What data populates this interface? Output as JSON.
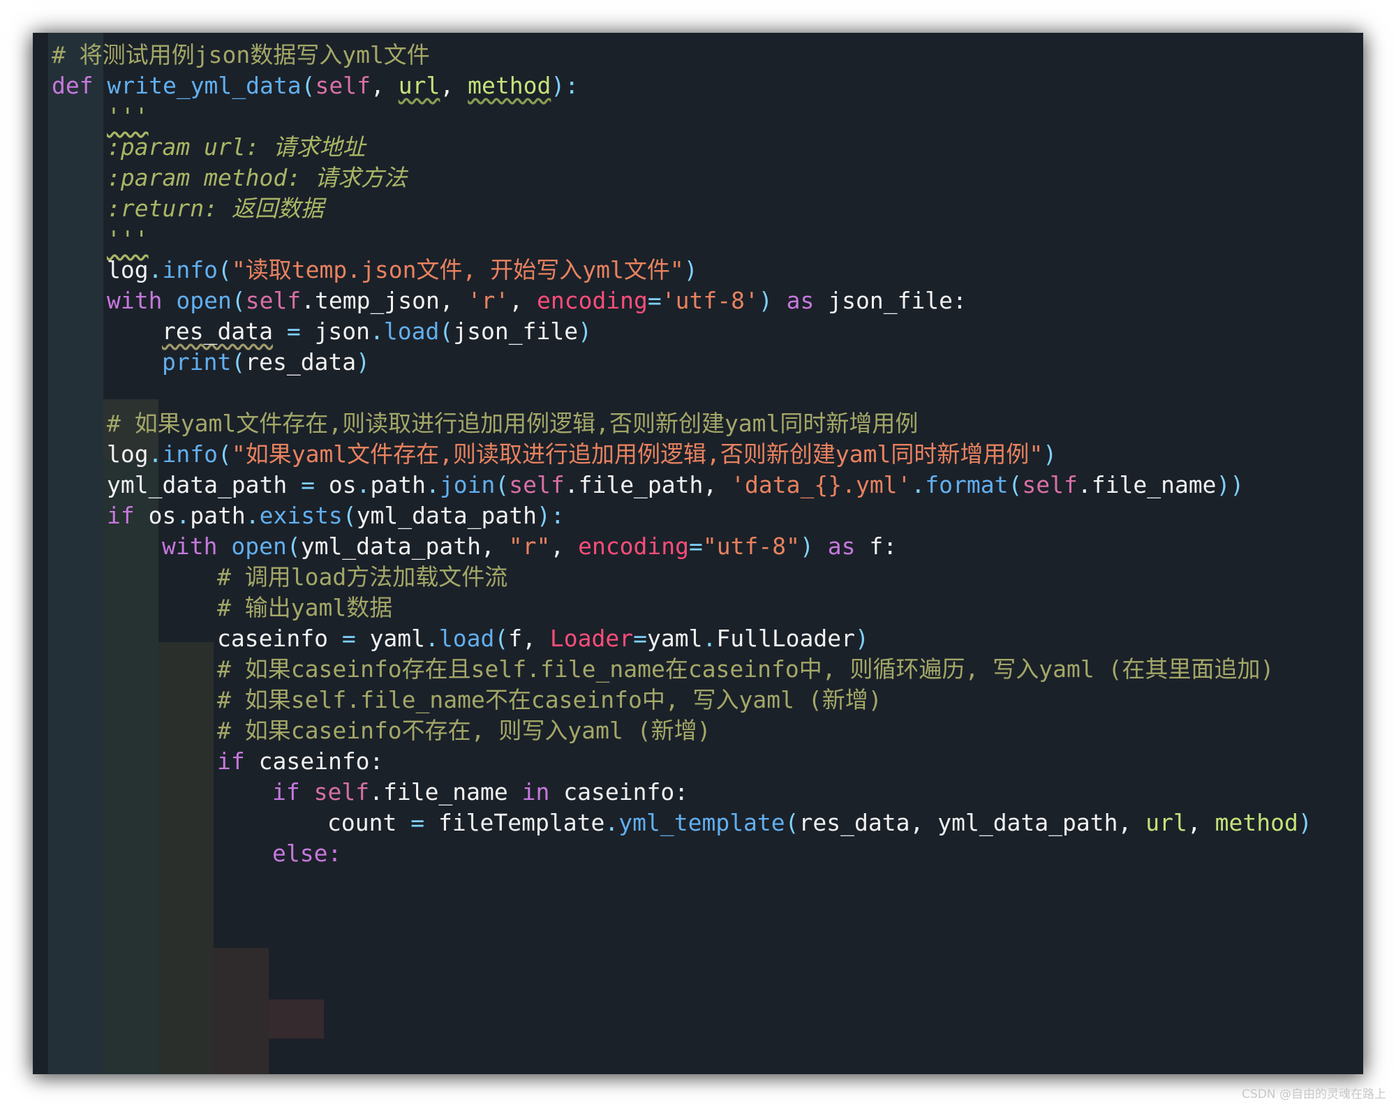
{
  "code_lines": [
    [
      {
        "t": "# 将测试用例json数据写入yml文件",
        "c": "c-comment"
      }
    ],
    [
      {
        "t": "def ",
        "c": "c-def"
      },
      {
        "t": "write_yml_data",
        "c": "c-fn"
      },
      {
        "t": "(",
        "c": "c-op"
      },
      {
        "t": "self",
        "c": "c-self"
      },
      {
        "t": ", ",
        "c": "c-plain"
      },
      {
        "t": "url",
        "c": "c-param"
      },
      {
        "t": ", ",
        "c": "c-plain"
      },
      {
        "t": "method",
        "c": "c-param"
      },
      {
        "t": "):",
        "c": "c-op"
      }
    ],
    [
      {
        "t": "'''",
        "c": "doc-quote"
      }
    ],
    [
      {
        "t": ":param url: ",
        "c": "c-doc"
      },
      {
        "t": "请求地址",
        "c": "c-doc"
      }
    ],
    [
      {
        "t": ":param method: ",
        "c": "c-doc"
      },
      {
        "t": "请求方法",
        "c": "c-doc"
      }
    ],
    [
      {
        "t": ":return: ",
        "c": "c-doc"
      },
      {
        "t": "返回数据",
        "c": "c-doc"
      }
    ],
    [
      {
        "t": "'''",
        "c": "doc-quote"
      }
    ],
    [
      {
        "t": "log",
        "c": "c-plain"
      },
      {
        "t": ".",
        "c": "c-op"
      },
      {
        "t": "info",
        "c": "c-call"
      },
      {
        "t": "(",
        "c": "c-op"
      },
      {
        "t": "\"读取temp.json文件, 开始写入yml文件\"",
        "c": "c-str"
      },
      {
        "t": ")",
        "c": "c-op"
      }
    ],
    [
      {
        "t": "with ",
        "c": "c-kw"
      },
      {
        "t": "open",
        "c": "c-call"
      },
      {
        "t": "(",
        "c": "c-op"
      },
      {
        "t": "self",
        "c": "c-self"
      },
      {
        "t": ".temp_json, ",
        "c": "c-plain"
      },
      {
        "t": "'r'",
        "c": "c-str"
      },
      {
        "t": ", ",
        "c": "c-plain"
      },
      {
        "t": "encoding",
        "c": "c-kwarg"
      },
      {
        "t": "=",
        "c": "c-op"
      },
      {
        "t": "'utf-8'",
        "c": "c-str"
      },
      {
        "t": ") ",
        "c": "c-op"
      },
      {
        "t": "as ",
        "c": "c-kw"
      },
      {
        "t": "json_file:",
        "c": "c-plain"
      }
    ],
    [
      {
        "t": "res_data",
        "c": "c-plain c-var-uw"
      },
      {
        "t": " = ",
        "c": "c-op"
      },
      {
        "t": "json",
        "c": "c-plain"
      },
      {
        "t": ".",
        "c": "c-op"
      },
      {
        "t": "load",
        "c": "c-call"
      },
      {
        "t": "(",
        "c": "c-op"
      },
      {
        "t": "json_file",
        "c": "c-plain"
      },
      {
        "t": ")",
        "c": "c-op"
      }
    ],
    [
      {
        "t": "print",
        "c": "c-call"
      },
      {
        "t": "(",
        "c": "c-op"
      },
      {
        "t": "res_data",
        "c": "c-plain"
      },
      {
        "t": ")",
        "c": "c-op"
      }
    ],
    [],
    [
      {
        "t": "# 如果yaml文件存在,则读取进行追加用例逻辑,否则新创建yaml同时新增用例",
        "c": "c-comment"
      }
    ],
    [
      {
        "t": "log",
        "c": "c-plain"
      },
      {
        "t": ".",
        "c": "c-op"
      },
      {
        "t": "info",
        "c": "c-call"
      },
      {
        "t": "(",
        "c": "c-op"
      },
      {
        "t": "\"如果yaml文件存在,则读取进行追加用例逻辑,否则新创建yaml同时新增用例\"",
        "c": "c-str"
      },
      {
        "t": ")",
        "c": "c-op"
      }
    ],
    [
      {
        "t": "yml_data_path",
        "c": "c-plain"
      },
      {
        "t": " = ",
        "c": "c-op"
      },
      {
        "t": "os",
        "c": "c-plain"
      },
      {
        "t": ".",
        "c": "c-op"
      },
      {
        "t": "path",
        "c": "c-plain"
      },
      {
        "t": ".",
        "c": "c-op"
      },
      {
        "t": "join",
        "c": "c-call"
      },
      {
        "t": "(",
        "c": "c-op"
      },
      {
        "t": "self",
        "c": "c-self"
      },
      {
        "t": ".file_path, ",
        "c": "c-plain"
      },
      {
        "t": "'data_{}.yml'",
        "c": "c-str"
      },
      {
        "t": ".",
        "c": "c-op"
      },
      {
        "t": "format",
        "c": "c-call"
      },
      {
        "t": "(",
        "c": "c-op"
      },
      {
        "t": "self",
        "c": "c-self"
      },
      {
        "t": ".file_name",
        "c": "c-plain"
      },
      {
        "t": "))",
        "c": "c-op"
      }
    ],
    [
      {
        "t": "if ",
        "c": "c-kw"
      },
      {
        "t": "os",
        "c": "c-plain"
      },
      {
        "t": ".",
        "c": "c-op"
      },
      {
        "t": "path",
        "c": "c-plain"
      },
      {
        "t": ".",
        "c": "c-op"
      },
      {
        "t": "exists",
        "c": "c-call"
      },
      {
        "t": "(",
        "c": "c-op"
      },
      {
        "t": "yml_data_path",
        "c": "c-plain"
      },
      {
        "t": "):",
        "c": "c-op"
      }
    ],
    [
      {
        "t": "with ",
        "c": "c-kw"
      },
      {
        "t": "open",
        "c": "c-call"
      },
      {
        "t": "(",
        "c": "c-op"
      },
      {
        "t": "yml_data_path, ",
        "c": "c-plain"
      },
      {
        "t": "\"r\"",
        "c": "c-str"
      },
      {
        "t": ", ",
        "c": "c-plain"
      },
      {
        "t": "encoding",
        "c": "c-kwarg"
      },
      {
        "t": "=",
        "c": "c-op"
      },
      {
        "t": "\"utf-8\"",
        "c": "c-str"
      },
      {
        "t": ") ",
        "c": "c-op"
      },
      {
        "t": "as ",
        "c": "c-kw"
      },
      {
        "t": "f:",
        "c": "c-plain"
      }
    ],
    [
      {
        "t": "# 调用load方法加载文件流",
        "c": "c-comment"
      }
    ],
    [
      {
        "t": "# 输出yaml数据",
        "c": "c-comment"
      }
    ],
    [
      {
        "t": "caseinfo",
        "c": "c-plain"
      },
      {
        "t": " = ",
        "c": "c-op"
      },
      {
        "t": "yaml",
        "c": "c-plain"
      },
      {
        "t": ".",
        "c": "c-op"
      },
      {
        "t": "load",
        "c": "c-call"
      },
      {
        "t": "(",
        "c": "c-op"
      },
      {
        "t": "f, ",
        "c": "c-plain"
      },
      {
        "t": "Loader",
        "c": "c-kwarg"
      },
      {
        "t": "=",
        "c": "c-op"
      },
      {
        "t": "yaml",
        "c": "c-plain"
      },
      {
        "t": ".",
        "c": "c-op"
      },
      {
        "t": "FullLoader",
        "c": "c-plain"
      },
      {
        "t": ")",
        "c": "c-op"
      }
    ],
    [
      {
        "t": "# 如果caseinfo存在且self.file_name在caseinfo中, 则循环遍历, 写入yaml (在其里面追加)",
        "c": "c-comment"
      }
    ],
    [
      {
        "t": "# 如果self.file_name不在caseinfo中, 写入yaml (新增)",
        "c": "c-comment"
      }
    ],
    [
      {
        "t": "# 如果caseinfo不存在, 则写入yaml (新增)",
        "c": "c-comment"
      }
    ],
    [
      {
        "t": "if ",
        "c": "c-kw"
      },
      {
        "t": "caseinfo:",
        "c": "c-plain"
      }
    ],
    [
      {
        "t": "if ",
        "c": "c-kw"
      },
      {
        "t": "self",
        "c": "c-self"
      },
      {
        "t": ".file_name ",
        "c": "c-plain"
      },
      {
        "t": "in ",
        "c": "c-kw"
      },
      {
        "t": "caseinfo:",
        "c": "c-plain"
      }
    ],
    [
      {
        "t": "count",
        "c": "c-plain"
      },
      {
        "t": " = ",
        "c": "c-op"
      },
      {
        "t": "fileTemplate",
        "c": "c-plain"
      },
      {
        "t": ".",
        "c": "c-op"
      },
      {
        "t": "yml_template",
        "c": "c-call"
      },
      {
        "t": "(",
        "c": "c-op"
      },
      {
        "t": "res_data, yml_data_path, ",
        "c": "c-plain"
      },
      {
        "t": "url",
        "c": "c-param-plain"
      },
      {
        "t": ", ",
        "c": "c-plain"
      },
      {
        "t": "method",
        "c": "c-param-plain"
      },
      {
        "t": ")",
        "c": "c-op"
      }
    ],
    [
      {
        "t": "else:",
        "c": "c-kw"
      }
    ]
  ],
  "watermark": "CSDN @自由的灵魂在路上"
}
